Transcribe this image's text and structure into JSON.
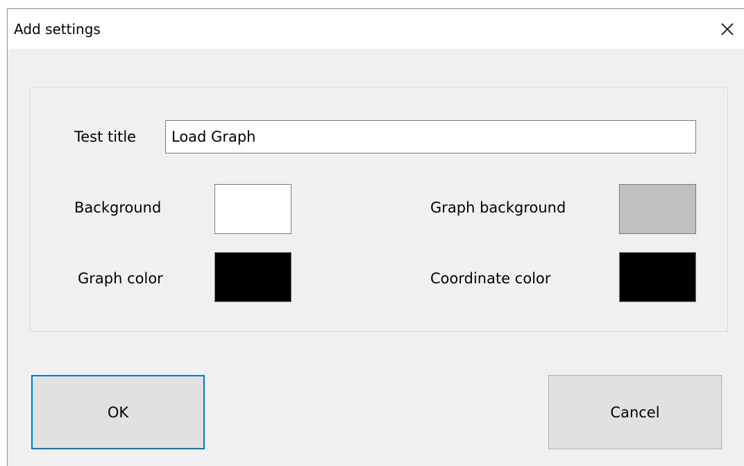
{
  "window": {
    "title": "Add settings"
  },
  "form": {
    "test_title_label": "Test title",
    "test_title_value": "Load Graph",
    "background_label": "Background",
    "graph_background_label": "Graph background",
    "graph_color_label": "Graph color",
    "coordinate_color_label": "Coordinate color"
  },
  "colors": {
    "background": "#ffffff",
    "graph_background": "#c0c0c0",
    "graph_color": "#000000",
    "coordinate_color": "#000000",
    "default_button_border": "#0078d7"
  },
  "buttons": {
    "ok_label": "OK",
    "cancel_label": "Cancel"
  },
  "icons": {
    "close": "close-icon"
  }
}
